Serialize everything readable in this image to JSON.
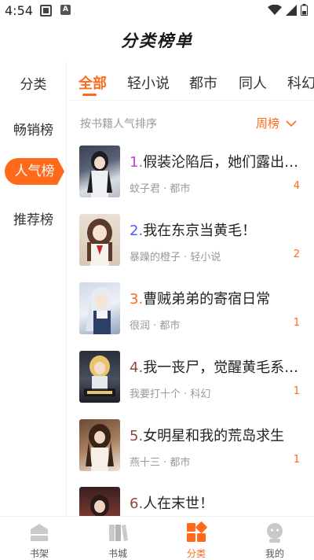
{
  "status": {
    "time": "4:54",
    "badge": "A"
  },
  "app_title": "分类榜单",
  "left_nav": [
    "分类",
    "畅销榜",
    "人气榜",
    "推荐榜"
  ],
  "tabs": [
    "全部",
    "轻小说",
    "都市",
    "同人",
    "科幻"
  ],
  "sort_label": "按书籍人气排序",
  "period": "周榜",
  "books": [
    {
      "rank": "1.",
      "title": "假装沦陷后，她们露出…",
      "meta": "蚊子君 · 都市",
      "count": "4"
    },
    {
      "rank": "2.",
      "title": "我在东京当黄毛！",
      "meta": "暴躁的橙子 · 轻小说",
      "count": "2"
    },
    {
      "rank": "3.",
      "title": "曹贼弟弟的寄宿日常",
      "meta": "很润 · 都市",
      "count": "1"
    },
    {
      "rank": "4.",
      "title": "我一丧尸，觉醒黄毛系…",
      "meta": "我要打十个 · 科幻",
      "count": "1"
    },
    {
      "rank": "5.",
      "title": "女明星和我的荒岛求生",
      "meta": "燕十三 · 都市",
      "count": "1"
    },
    {
      "rank": "6.",
      "title": "人在末世！",
      "meta": "",
      "count": ""
    }
  ],
  "bottom_nav": [
    "书架",
    "书城",
    "分类",
    "我的"
  ],
  "colors": {
    "accent": "#ff6a1a",
    "rank1": "#c33fd6",
    "rank2": "#4a5ee5",
    "rank3": "#ff6a1a",
    "rank_other": "#8b4a3a"
  }
}
